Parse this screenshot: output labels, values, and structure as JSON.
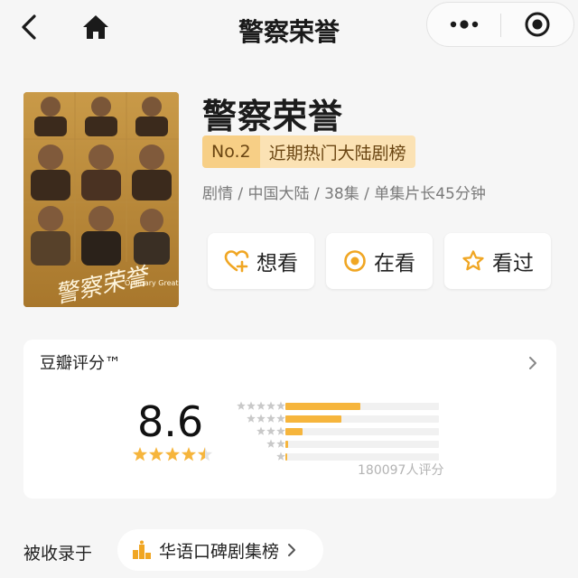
{
  "nav": {
    "title": "警察荣誉"
  },
  "show": {
    "title": "警察荣誉",
    "rank_no": "No.2",
    "rank_name": "近期热门大陆剧榜",
    "meta": "剧情 / 中国大陆 / 38集 / 单集片长45分钟",
    "poster_title": "警察荣誉",
    "poster_subtitle": "Ordinary Greatness"
  },
  "actions": {
    "want": "想看",
    "watching": "在看",
    "watched": "看过"
  },
  "rating": {
    "label": "豆瓣评分™",
    "score": "8.6",
    "stars_value": 4.5,
    "distribution_percent": [
      48.6,
      36.3,
      10.9,
      2.0,
      1.3
    ],
    "count_text": "180097人评分"
  },
  "included": {
    "label": "被收录于",
    "list_name": "华语口碑剧集榜"
  },
  "colors": {
    "accent": "#f6b53c",
    "badge": "#f7cf86",
    "background": "#f6f6f6"
  },
  "icons": [
    "back-arrow-icon",
    "home-icon",
    "more-dots-icon",
    "target-icon",
    "heart-plus-icon",
    "watching-icon",
    "star-outline-icon",
    "chevron-right-icon",
    "ranking-icon"
  ]
}
